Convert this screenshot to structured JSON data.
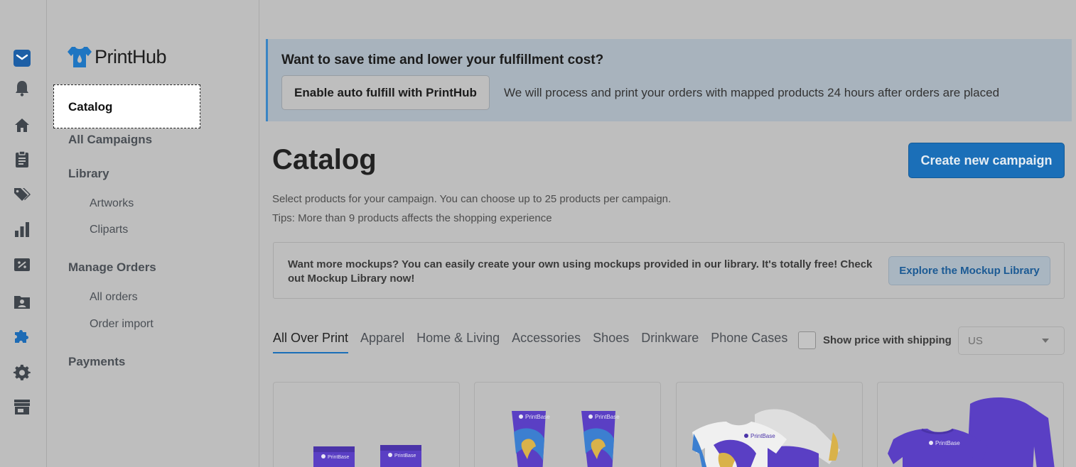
{
  "rail": {
    "icons": [
      "inbox-icon",
      "bell-icon",
      "home-icon",
      "orders-icon",
      "tags-icon",
      "analytics-icon",
      "discount-icon",
      "customers-icon",
      "apps-icon",
      "settings-icon",
      "store-icon"
    ]
  },
  "sidebar": {
    "logo_text": "PrintHub",
    "active_item": "Catalog",
    "all_campaigns": "All Campaigns",
    "library": "Library",
    "artworks": "Artworks",
    "cliparts": "Cliparts",
    "manage_orders": "Manage Orders",
    "all_orders": "All orders",
    "order_import": "Order import",
    "payments": "Payments"
  },
  "banner": {
    "title": "Want to save time and lower your fulfillment cost?",
    "button": "Enable auto fulfill with PrintHub",
    "description": "We will process and print your orders with mapped products 24 hours after orders are placed"
  },
  "main": {
    "title": "Catalog",
    "create_button": "Create new campaign",
    "subtitle": "Select products for your campaign. You can choose up to 25 products per campaign.",
    "tips": "Tips: More than 9 products affects the shopping experience"
  },
  "mockup": {
    "text": "Want more mockups? You can easily create your own using mockups provided in our library. It's totally free! Check out Mockup Library now!",
    "button": "Explore the Mockup Library"
  },
  "tabs": [
    "All Over Print",
    "Apparel",
    "Home & Living",
    "Accessories",
    "Shoes",
    "Drinkware",
    "Phone Cases"
  ],
  "shipping": {
    "label": "Show price with shipping",
    "country": "US"
  },
  "products": [
    {
      "name": "socks",
      "brand": "PrintBase"
    },
    {
      "name": "leg-sleeves",
      "brand": "PrintBase"
    },
    {
      "name": "tshirts",
      "brand": "PrintBase"
    },
    {
      "name": "sweatshirts",
      "brand": "PrintBase"
    }
  ],
  "colors": {
    "accent": "#1b6fb8",
    "product_purple": "#5a3fc4"
  }
}
